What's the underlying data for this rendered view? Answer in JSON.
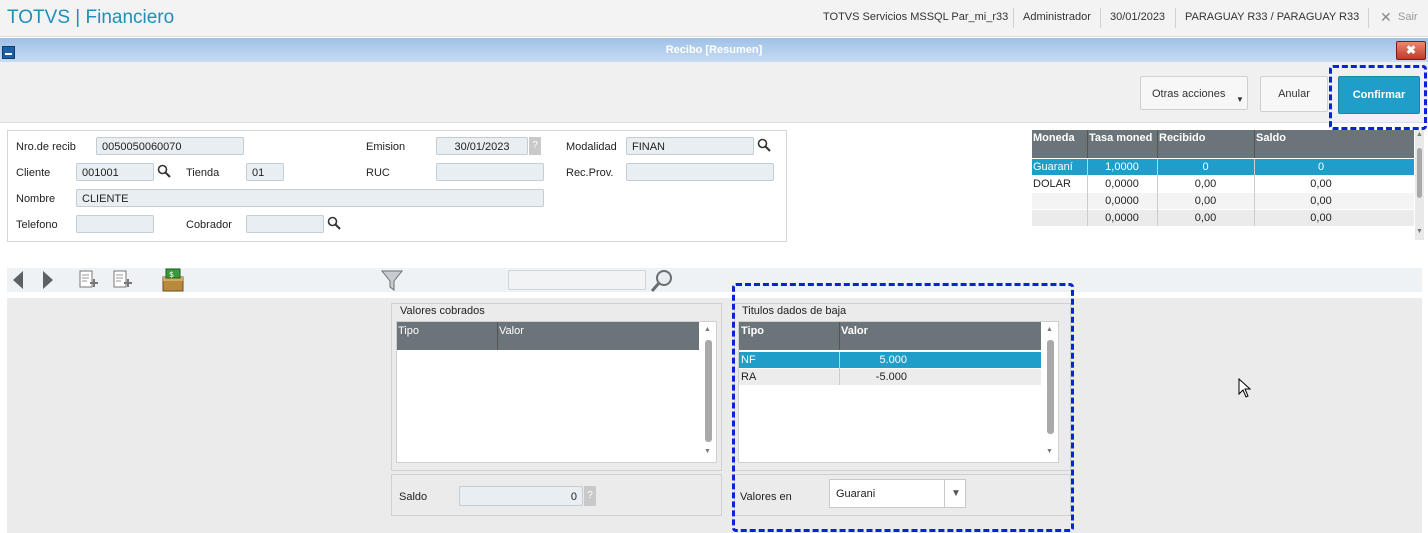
{
  "header": {
    "brand": "TOTVS | Financiero",
    "environment": "TOTVS Servicios MSSQL Par_mi_r33",
    "user": "Administrador",
    "date": "30/01/2023",
    "company": "PARAGUAY R33 / PARAGUAY R33",
    "exit_label": "Sair"
  },
  "window": {
    "title": "Recibo [Resumen]",
    "close_glyph": "✖"
  },
  "actions": {
    "other_actions": "Otras acciones",
    "cancel": "Anular",
    "confirm": "Confirmar"
  },
  "form": {
    "receipt_no_label": "Nro.de recib",
    "receipt_no": "0050050060070",
    "emission_label": "Emision",
    "emission": "30/01/2023",
    "modality_label": "Modalidad",
    "modality": "FINAN",
    "client_label": "Cliente",
    "client": "001001",
    "store_label": "Tienda",
    "store": "01",
    "ruc_label": "RUC",
    "ruc": "",
    "recprov_label": "Rec.Prov.",
    "recprov": "",
    "name_label": "Nombre",
    "name": "CLIENTE",
    "phone_label": "Telefono",
    "phone": "",
    "collector_label": "Cobrador",
    "collector": "",
    "help_glyph": "?"
  },
  "currency_grid": {
    "headers": [
      "Moneda",
      "Tasa moned",
      "Recibido",
      "Saldo"
    ],
    "rows": [
      [
        "Guaraní",
        "1,0000",
        "0",
        "0"
      ],
      [
        "DOLAR",
        "0,0000",
        "0,00",
        "0,00"
      ],
      [
        "",
        "0,0000",
        "0,00",
        "0,00"
      ],
      [
        "",
        "0,0000",
        "0,00",
        "0,00"
      ]
    ]
  },
  "toolbar": {
    "search_value": ""
  },
  "valores_cobrados": {
    "title": "Valores cobrados",
    "headers": [
      "Tipo",
      "Valor"
    ],
    "saldo_label": "Saldo",
    "saldo_value": "0"
  },
  "titulos": {
    "title": "Titulos dados de baja",
    "headers": [
      "Tipo",
      "Valor"
    ],
    "rows": [
      [
        "NF",
        "5.000"
      ],
      [
        "RA",
        "-5.000"
      ]
    ],
    "currency_label": "Valores en",
    "currency_value": "Guarani"
  },
  "colors": {
    "brand": "#1f8fb8",
    "primary": "#1f9ec9",
    "selected_row": "#1f9ec9",
    "grid_header": "#6b7478",
    "highlight": "#0a22d9"
  }
}
